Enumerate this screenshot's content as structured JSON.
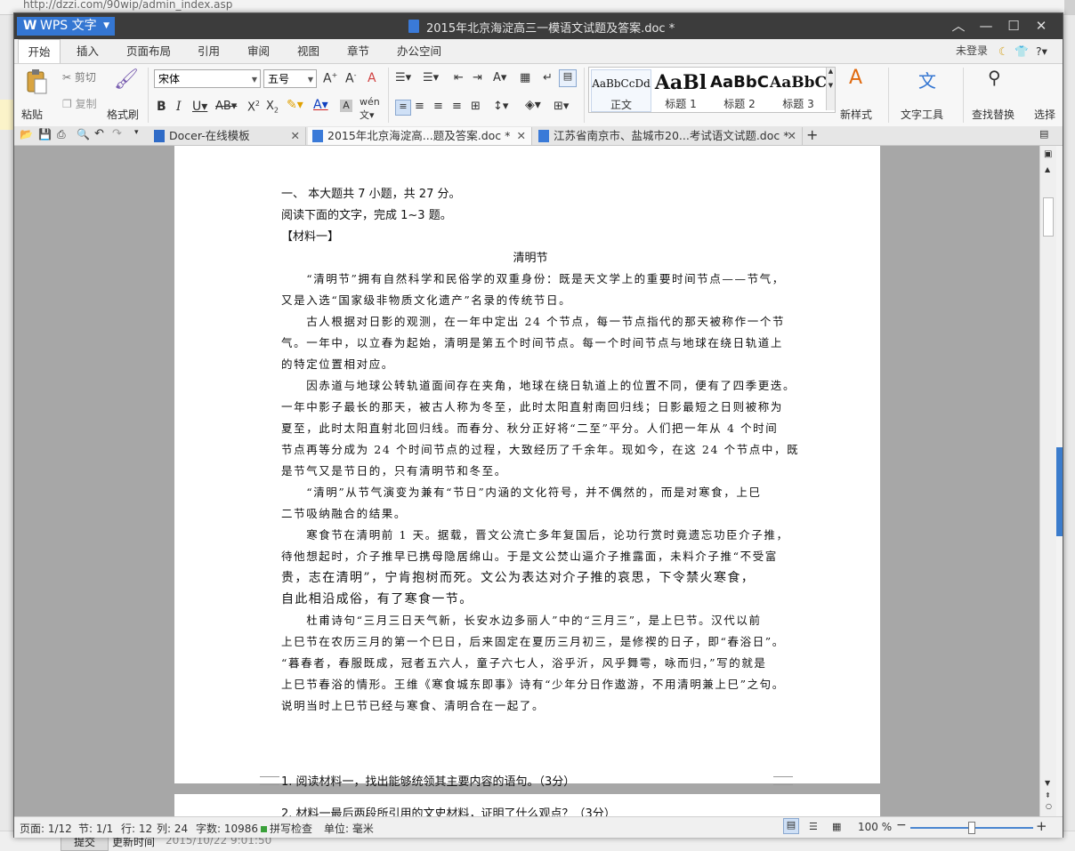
{
  "background": {
    "url": "http://dzzi.com/90wip/admin_index.asp",
    "submit_label": "提交",
    "update_label": "更新时间",
    "update_time": "2015/10/22 9:01:50"
  },
  "titlebar": {
    "app_name": "WPS 文字",
    "doc_title": "2015年北京海淀高三一模语文试题及答案.doc *"
  },
  "menu": {
    "items": [
      "开始",
      "插入",
      "页面布局",
      "引用",
      "审阅",
      "视图",
      "章节",
      "办公空间"
    ],
    "login": "未登录"
  },
  "ribbon": {
    "paste": "粘贴",
    "cut": "剪切",
    "copy": "复制",
    "format_painter": "格式刷",
    "font_name": "宋体",
    "font_size": "五号",
    "styles": [
      {
        "preview": "AaBbCcDd",
        "label": "正文"
      },
      {
        "preview": "AaBl",
        "label": "标题 1"
      },
      {
        "preview": "AaBbC",
        "label": "标题 2"
      },
      {
        "preview": "AaBbC",
        "label": "标题 3"
      }
    ],
    "new_style": "新样式",
    "text_tools": "文字工具",
    "find_replace": "查找替换",
    "select": "选择"
  },
  "tabs": [
    {
      "label": "Docer-在线模板"
    },
    {
      "label": "2015年北京海淀高...题及答案.doc *"
    },
    {
      "label": "江苏省南京市、盐城市20...考试语文试题.doc *"
    }
  ],
  "document": {
    "section_head": "一、  本大题共 7 小题，共 27 分。",
    "instruction": "阅读下面的文字，完成 1~3 题。",
    "material_label": "【材料一】",
    "article_title": "清明节",
    "lines": [
      "　　“清明节”拥有自然科学和民俗学的双重身份：既是天文学上的重要时间节点——节气，",
      "又是入选“国家级非物质文化遗产”名录的传统节日。",
      "　　古人根据对日影的观测，在一年中定出 24 个节点，每一节点指代的那天被称作一个节",
      "气。一年中，以立春为起始，清明是第五个时间节点。每一个时间节点与地球在绕日轨道上",
      "的特定位置相对应。",
      "　　因赤道与地球公转轨道面间存在夹角，地球在绕日轨道上的位置不同，便有了四季更迭。",
      "一年中影子最长的那天，被古人称为冬至，此时太阳直射南回归线；日影最短之日则被称为",
      "夏至，此时太阳直射北回归线。而春分、秋分正好将“二至”平分。人们把一年从 4 个时间",
      "节点再等分成为 24 个时间节点的过程，大致经历了千余年。现如今，在这 24 个节点中，既",
      "是节气又是节日的，只有清明节和冬至。",
      "　　“清明”从节气演变为兼有“节日”内涵的文化符号，并不偶然的，而是对寒食，上巳",
      "二节吸纳融合的结果。",
      "　　寒食节在清明前 1 天。据载，晋文公流亡多年复国后，论功行赏时竟遗忘功臣介子推，",
      "待他想起时，介子推早已携母隐居绵山。于是文公焚山逼介子推露面，未料介子推“不受富",
      "贵，志在清明”，宁肯抱树而死。文公为表达对介子推的哀思，下令禁火寒食，",
      "自此相沿成俗，有了寒食一节。",
      "　　杜甫诗句“三月三日天气新，长安水边多丽人”中的“三月三”，是上巳节。汉代以前",
      "上巳节在农历三月的第一个巳日，后来固定在夏历三月初三，是修禊的日子，即“春浴日”。",
      "“暮春者，春服既成，冠者五六人，童子六七人，浴乎沂，风乎舞雩，咏而归，”写的就是",
      "上巳节春浴的情形。王维《寒食城东即事》诗有“少年分日作遨游，不用清明兼上巳”之句。",
      "说明当时上巳节已经与寒食、清明合在一起了。"
    ],
    "question1": "1. 阅读材料一，找出能够统领其主要内容的语句。（3分）",
    "question2": "2. 材料一最后两段所引用的文史材料，证明了什么观点？（3分）"
  },
  "status": {
    "page": "页面: 1/12",
    "section": "节: 1/1",
    "row": "行: 12",
    "col": "列: 24",
    "word_count": "字数: 10986",
    "spell_check": "拼写检查",
    "unit": "单位: 毫米",
    "zoom": "100 %",
    "zoom_level": 0.5
  },
  "colors": {
    "titlebar": "#3c3c3c",
    "accent": "#3476d2",
    "doc_background": "#a7a7a7"
  }
}
